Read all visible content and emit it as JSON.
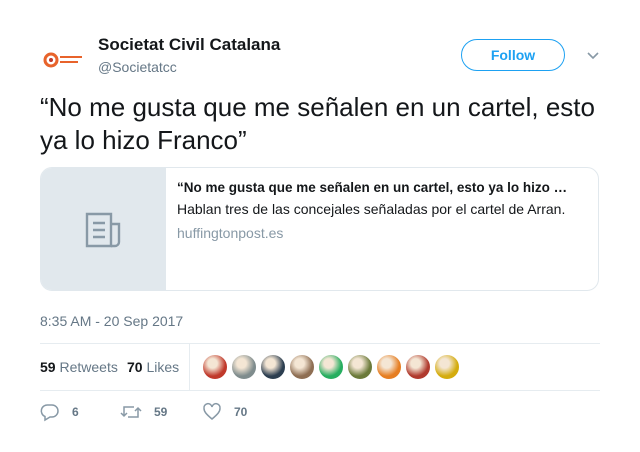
{
  "account": {
    "name": "Societat Civil Catalana",
    "handle": "@Societatcc",
    "follow_label": "Follow",
    "brand_color": "#1da1f2"
  },
  "tweet": {
    "text": "“No me gusta que me señalen en un cartel, esto ya lo hizo Franco”"
  },
  "card": {
    "title": "“No me gusta que me señalen en un cartel, esto ya lo hizo …",
    "description": "Hablan tres de las concejales señaladas por el cartel de Arran.",
    "domain": "huffingtonpost.es",
    "image_icon": "document-icon"
  },
  "timestamp": "8:35 AM - 20 Sep 2017",
  "stats": {
    "retweets_count": "59",
    "retweets_label": "Retweets",
    "likes_count": "70",
    "likes_label": "Likes"
  },
  "likers": [
    {
      "name": "liker-avatar-1",
      "color": "#c0392b"
    },
    {
      "name": "liker-avatar-2",
      "color": "#7f8c8d"
    },
    {
      "name": "liker-avatar-3",
      "color": "#2c3e50"
    },
    {
      "name": "liker-avatar-4",
      "color": "#8e6e53"
    },
    {
      "name": "liker-avatar-5",
      "color": "#27ae60"
    },
    {
      "name": "liker-avatar-6",
      "color": "#6b7a3a"
    },
    {
      "name": "liker-avatar-7",
      "color": "#e67e22"
    },
    {
      "name": "liker-avatar-8",
      "color": "#b03a2e"
    },
    {
      "name": "liker-avatar-9",
      "color": "#d4ac0d"
    }
  ],
  "actions": {
    "reply_count": "6",
    "retweet_count": "59",
    "like_count": "70"
  }
}
